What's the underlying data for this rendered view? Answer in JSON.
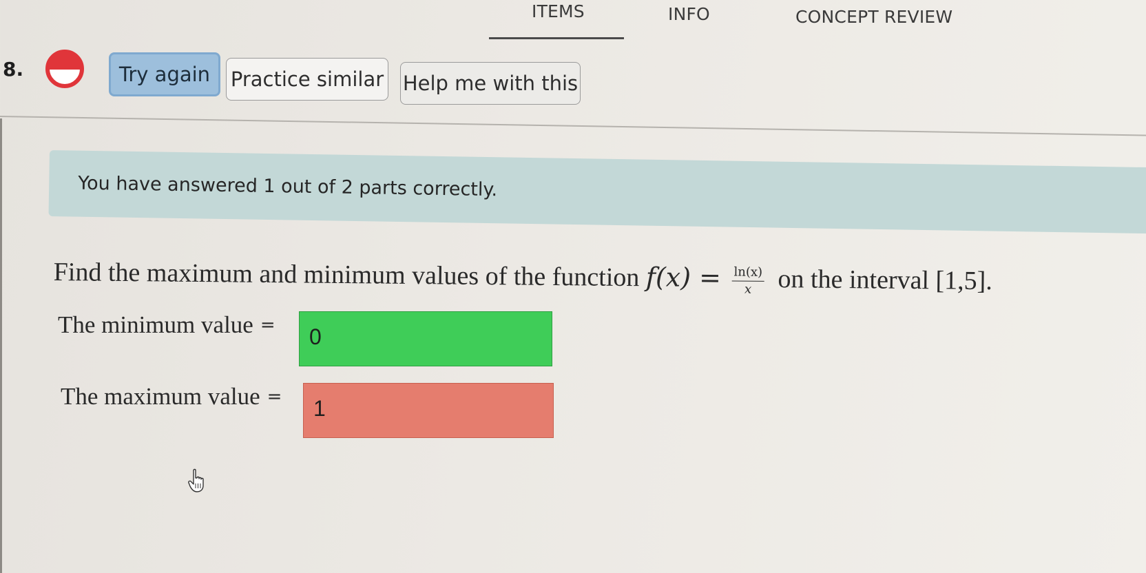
{
  "nav": {
    "tabs": [
      {
        "label": "ITEMS"
      },
      {
        "label": "INFO"
      },
      {
        "label": "CONCEPT REVIEW"
      }
    ],
    "active_tab": "ITEMS"
  },
  "question_header": {
    "number": "8.",
    "status": "partially-correct",
    "status_color": "#e0353a",
    "buttons": {
      "try_again": "Try again",
      "practice_similar": "Practice similar",
      "help": "Help me with this"
    }
  },
  "feedback": {
    "message": "You have answered 1 out of 2 parts correctly."
  },
  "question": {
    "text_before": "Find the maximum and minimum values of the function",
    "function_lhs": "f(x) =",
    "fraction_numerator": "ln(x)",
    "fraction_denominator": "x",
    "text_after": "on the interval [1,5]."
  },
  "answers": [
    {
      "label": "The minimum value",
      "equals": "=",
      "value": "0",
      "state": "correct",
      "color": "#3fcd58"
    },
    {
      "label": "The maximum value",
      "equals": "=",
      "value": "1",
      "state": "incorrect",
      "color": "#e57d6e"
    }
  ]
}
